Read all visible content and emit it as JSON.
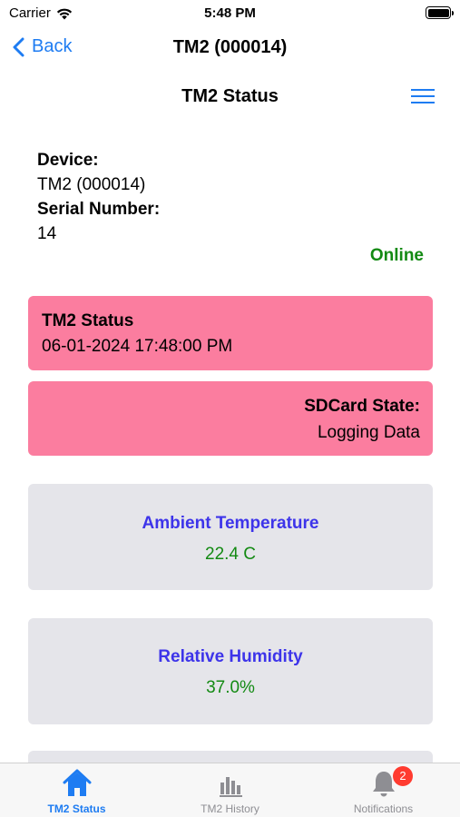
{
  "status_bar": {
    "carrier": "Carrier",
    "time": "5:48 PM"
  },
  "nav": {
    "back_label": "Back",
    "title": "TM2 (000014)"
  },
  "page": {
    "title": "TM2 Status"
  },
  "device": {
    "device_label": "Device:",
    "device_value": "TM2 (000014)",
    "serial_label": "Serial Number:",
    "serial_value": "14",
    "connection_status": "Online"
  },
  "status_card": {
    "title": "TM2 Status",
    "timestamp": "06-01-2024 17:48:00 PM"
  },
  "sdcard": {
    "label": "SDCard State:",
    "value": "Logging Data"
  },
  "readings": [
    {
      "label": "Ambient Temperature",
      "value": "22.4 C"
    },
    {
      "label": "Relative Humidity",
      "value": "37.0%"
    }
  ],
  "tabs": [
    {
      "label": "TM2 Status",
      "icon": "home-icon",
      "active": true
    },
    {
      "label": "TM2 History",
      "icon": "bar-chart-icon",
      "active": false
    },
    {
      "label": "Notifications",
      "icon": "bell-icon",
      "active": false,
      "badge": "2"
    }
  ],
  "colors": {
    "accent": "#1e7cf2",
    "status_card_bg": "#fb7d9f",
    "reading_card_bg": "#e5e5ea",
    "reading_title": "#3d34ea",
    "reading_value": "#138a13",
    "online": "#138a13",
    "badge": "#ff3b30"
  }
}
